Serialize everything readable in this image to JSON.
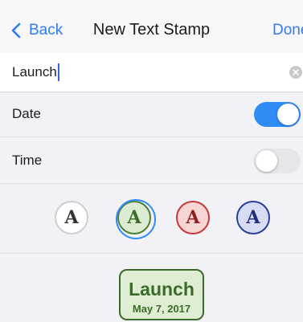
{
  "colors": {
    "accent": "#2f8cf6",
    "link": "#2f7cf6",
    "stamp_border": "#3a6b2a",
    "stamp_fill": "#dfeed3"
  },
  "navbar": {
    "back_label": "Back",
    "back_icon": "chevron-left-icon",
    "title": "New Text Stamp",
    "done_label": "Done"
  },
  "text_field": {
    "value": "Launch",
    "clear_icon": "clear-icon"
  },
  "options": [
    {
      "label": "Date",
      "enabled": true
    },
    {
      "label": "Time",
      "enabled": false
    }
  ],
  "styles": [
    {
      "letter": "A",
      "name": "neutral",
      "fill": "#ffffff",
      "stroke": "#cfcfd3",
      "color": "#333333",
      "selected": false
    },
    {
      "letter": "A",
      "name": "green",
      "fill": "#dcebd2",
      "stroke": "#4a7f35",
      "color": "#3b6b28",
      "selected": true
    },
    {
      "letter": "A",
      "name": "red",
      "fill": "#f7d5d5",
      "stroke": "#c23b3b",
      "color": "#8e2020",
      "selected": false
    },
    {
      "letter": "A",
      "name": "blue",
      "fill": "#d8dcf2",
      "stroke": "#2a3f9a",
      "color": "#1f2f7a",
      "selected": false
    }
  ],
  "preview": {
    "title": "Launch",
    "date": "May 7, 2017"
  }
}
